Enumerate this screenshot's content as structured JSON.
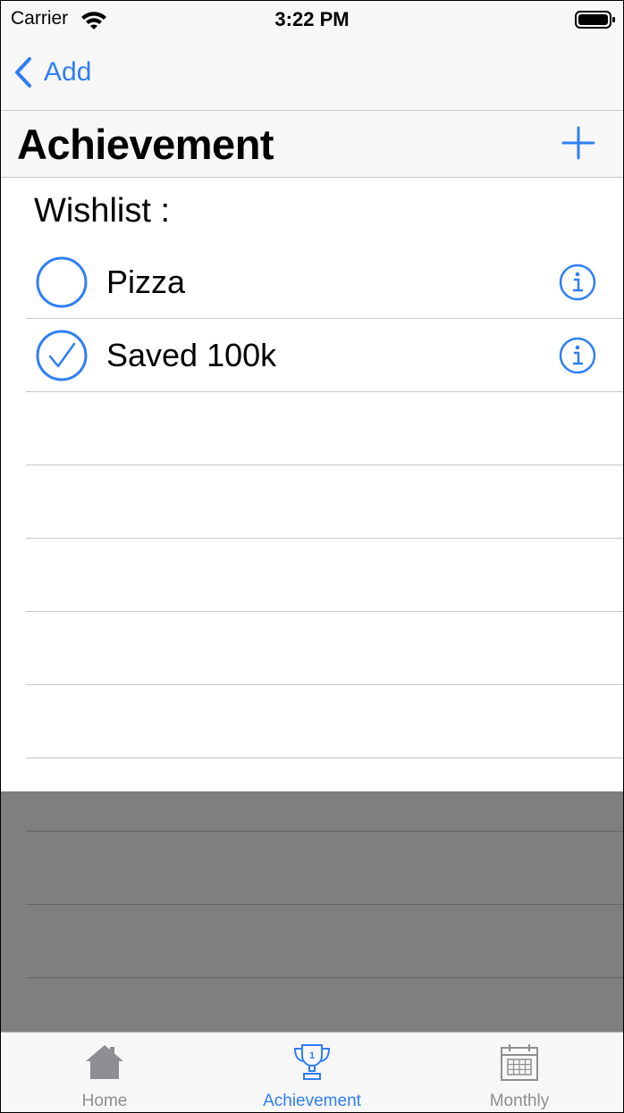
{
  "status_bar": {
    "carrier": "Carrier",
    "time": "3:22 PM"
  },
  "nav": {
    "back_label": "Add"
  },
  "header": {
    "title": "Achievement"
  },
  "list": {
    "section_label": "Wishlist :",
    "items": [
      {
        "label": "Pizza",
        "checked": false
      },
      {
        "label": "Saved 100k",
        "checked": true
      }
    ]
  },
  "tabs": [
    {
      "label": "Home",
      "icon": "house-icon",
      "selected": false
    },
    {
      "label": "Achievement",
      "icon": "trophy-icon",
      "selected": true
    },
    {
      "label": "Monthly",
      "icon": "calendar-icon",
      "selected": false
    }
  ],
  "colors": {
    "accent": "#2f7ff5",
    "inactive": "#8e8e93",
    "bar_bg": "#f7f7f7",
    "separator": "#c8c7cc"
  }
}
